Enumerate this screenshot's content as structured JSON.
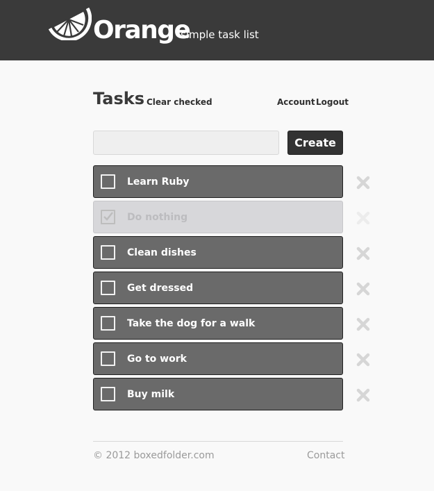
{
  "header": {
    "brand": "Orange",
    "tagline": "simple task list",
    "logo_icon": "orange-slice-icon"
  },
  "page": {
    "title": "Tasks",
    "clear_checked": "Clear checked",
    "account": "Account",
    "logout": "Logout"
  },
  "new_task": {
    "placeholder": "",
    "value": "",
    "create_label": "Create"
  },
  "tasks": [
    {
      "label": "Learn Ruby",
      "checked": false
    },
    {
      "label": "Do nothing",
      "checked": true
    },
    {
      "label": "Clean dishes",
      "checked": false
    },
    {
      "label": "Get dressed",
      "checked": false
    },
    {
      "label": "Take the dog for a walk",
      "checked": false
    },
    {
      "label": "Go to work",
      "checked": false
    },
    {
      "label": "Buy milk",
      "checked": false
    }
  ],
  "icons": {
    "checkbox": "checkbox-icon",
    "checkmark": "checkmark-icon",
    "delete": "close-icon"
  },
  "footer": {
    "copyright": "© 2012 boxedfolder.com",
    "contact": "Contact"
  },
  "colors": {
    "header_bg": "#3a3a3a",
    "task_bg": "#6a6a6a",
    "task_checked_bg": "#d7d7da",
    "page_bg": "#f9f9f9"
  }
}
